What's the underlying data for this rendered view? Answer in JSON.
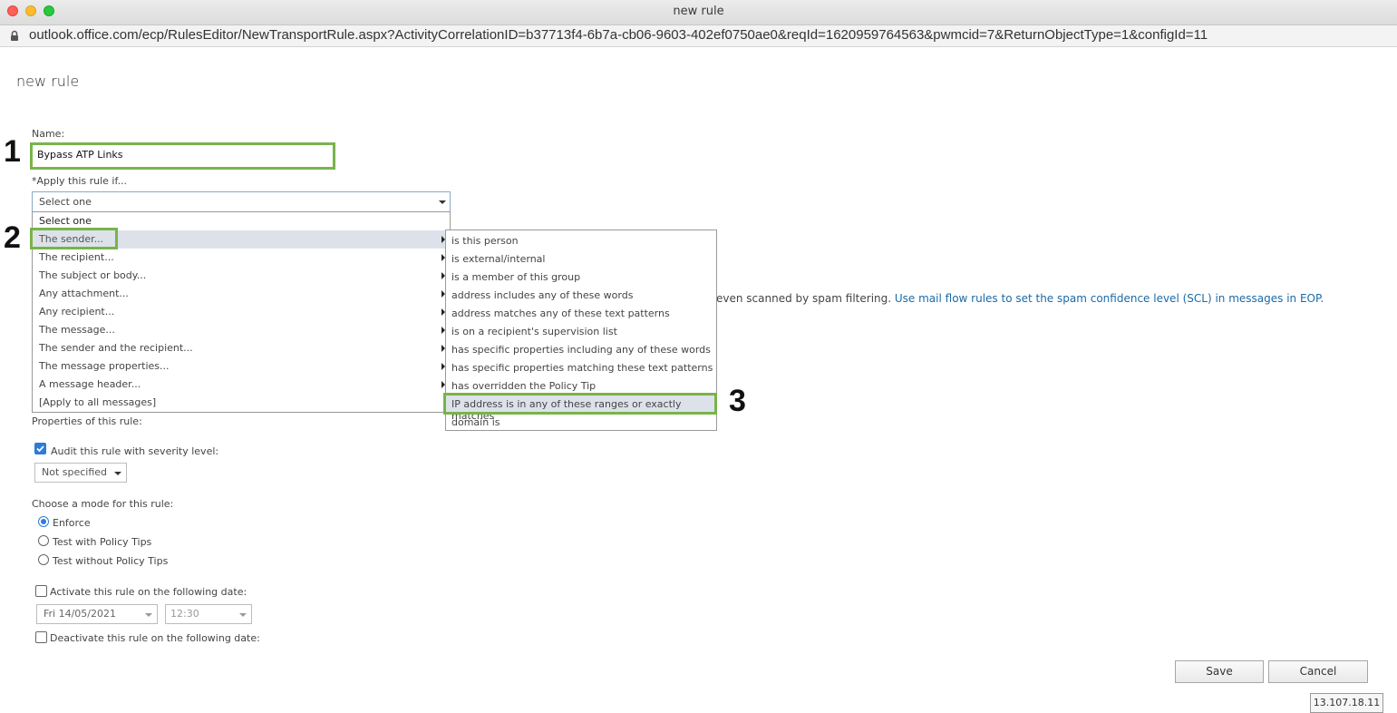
{
  "window": {
    "title": "new rule",
    "url": "outlook.office.com/ecp/RulesEditor/NewTransportRule.aspx?ActivityCorrelationID=b37713f4-6b7a-cb06-9603-402ef0750ae0&reqId=1620959764563&pwmcid=7&ReturnObjectType=1&configId=11"
  },
  "page": {
    "title": "new rule",
    "name_label": "Name:",
    "name_value": "Bypass ATP Links",
    "apply_label": "*Apply this rule if...",
    "select_value": "Select one",
    "steps": [
      "1",
      "2",
      "3"
    ]
  },
  "condition_menu": {
    "header": "Select one",
    "items": [
      "The sender...",
      "The recipient...",
      "The subject or body...",
      "Any attachment...",
      "Any recipient...",
      "The message...",
      "The sender and the recipient...",
      "The message properties...",
      "A message header...",
      "[Apply to all messages]"
    ]
  },
  "sender_submenu": {
    "items": [
      "is this person",
      "is external/internal",
      "is a member of this group",
      "address includes any of these words",
      "address matches any of these text patterns",
      "is on a recipient's supervision list",
      "has specific properties including any of these words",
      "has specific properties matching these text patterns",
      "has overridden the Policy Tip",
      "IP address is in any of these ranges or exactly matches",
      "domain is"
    ]
  },
  "spam_note": {
    "text": "even scanned by spam filtering. ",
    "link": "Use mail flow rules to set the spam confidence level (SCL) in messages in EOP."
  },
  "properties": {
    "label": "Properties of this rule:",
    "audit_label": "Audit this rule with severity level:",
    "audit_checked": true,
    "severity_value": "Not specified",
    "mode_label": "Choose a mode for this rule:",
    "modes": [
      "Enforce",
      "Test with Policy Tips",
      "Test without Policy Tips"
    ],
    "selected_mode": "Enforce",
    "activate_label": "Activate this rule on the following date:",
    "activate_date": "Fri 14/05/2021",
    "activate_time": "12:30",
    "deactivate_label": "Deactivate this rule on the following date:"
  },
  "buttons": {
    "save": "Save",
    "cancel": "Cancel"
  },
  "status": {
    "ip": "13.107.18.11"
  },
  "colors": {
    "highlight": "#78b44a",
    "link": "#1a6aa8",
    "hover_row": "#dde2ea"
  }
}
